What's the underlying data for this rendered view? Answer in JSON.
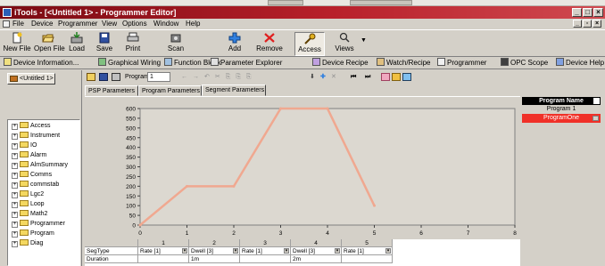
{
  "window": {
    "title": "iTools - [<Untitled 1> - Programmer Editor]"
  },
  "menu": [
    "File",
    "Device",
    "Programmer",
    "View",
    "Options",
    "Window",
    "Help"
  ],
  "toolbar": {
    "buttons": [
      {
        "label": "New File",
        "icon": "new-file-icon"
      },
      {
        "label": "Open File",
        "icon": "open-file-icon"
      },
      {
        "label": "Load",
        "icon": "load-icon"
      },
      {
        "label": "Save",
        "icon": "save-icon"
      },
      {
        "label": "Print",
        "icon": "print-icon"
      },
      {
        "label": "Scan",
        "icon": "scan-icon"
      },
      {
        "label": "Add",
        "icon": "add-icon"
      },
      {
        "label": "Remove",
        "icon": "remove-icon"
      },
      {
        "label": "Access",
        "icon": "key-icon"
      },
      {
        "label": "Views",
        "icon": "views-icon"
      }
    ]
  },
  "toolbar2": [
    "Device Information...",
    "Graphical Wiring",
    "Function Block",
    "Parameter Explorer",
    "Device Recipe",
    "Watch/Recipe",
    "Programmer",
    "OPC Scope",
    "Device Help"
  ],
  "tree": {
    "root": "<Untitled 1>",
    "items": [
      "Access",
      "Instrument",
      "IO",
      "Alarm",
      "AlmSummary",
      "Comms",
      "commstab",
      "Lgc2",
      "Loop",
      "Math2",
      "Programmer",
      "Program",
      "Diag"
    ]
  },
  "editor": {
    "program_label": "Program",
    "program_value": "1",
    "tabs": [
      "PSP Parameters",
      "Program Parameters",
      "Segment Parameters"
    ],
    "active_tab": "Segment Parameters"
  },
  "chart_data": {
    "type": "line",
    "x": [
      0,
      1,
      2,
      3,
      4,
      5
    ],
    "values": [
      0,
      200,
      200,
      600,
      600,
      100
    ],
    "x_ticks": [
      "0",
      "1",
      "2",
      "3",
      "4",
      "5",
      "6",
      "7",
      "8"
    ],
    "y_ticks": [
      "0",
      "50",
      "100",
      "150",
      "200",
      "250",
      "300",
      "350",
      "400",
      "450",
      "500",
      "550",
      "600"
    ],
    "xlim": [
      0,
      8
    ],
    "ylim": [
      0,
      600
    ],
    "grid": false,
    "line_color": "#f0a890",
    "plot_bg": "#dcd8d0"
  },
  "segment_table": {
    "columns": [
      "1",
      "2",
      "3",
      "4",
      "5"
    ],
    "rows": [
      {
        "label": "SegType",
        "values": [
          "Rate [1]",
          "Dwell [3]",
          "Rate [1]",
          "Dwell [3]",
          "Rate [1]"
        ]
      },
      {
        "label": "Duration",
        "values": [
          "",
          "1m",
          "",
          "2m",
          ""
        ]
      }
    ]
  },
  "program_panel": {
    "header": "Program Name",
    "items": [
      "Program 1",
      "ProgramOne"
    ],
    "selected_index": 1
  },
  "colors": {
    "titlebar": "#9c1a22",
    "selection_red": "#f03028",
    "window_gray": "#d4d0c8"
  }
}
